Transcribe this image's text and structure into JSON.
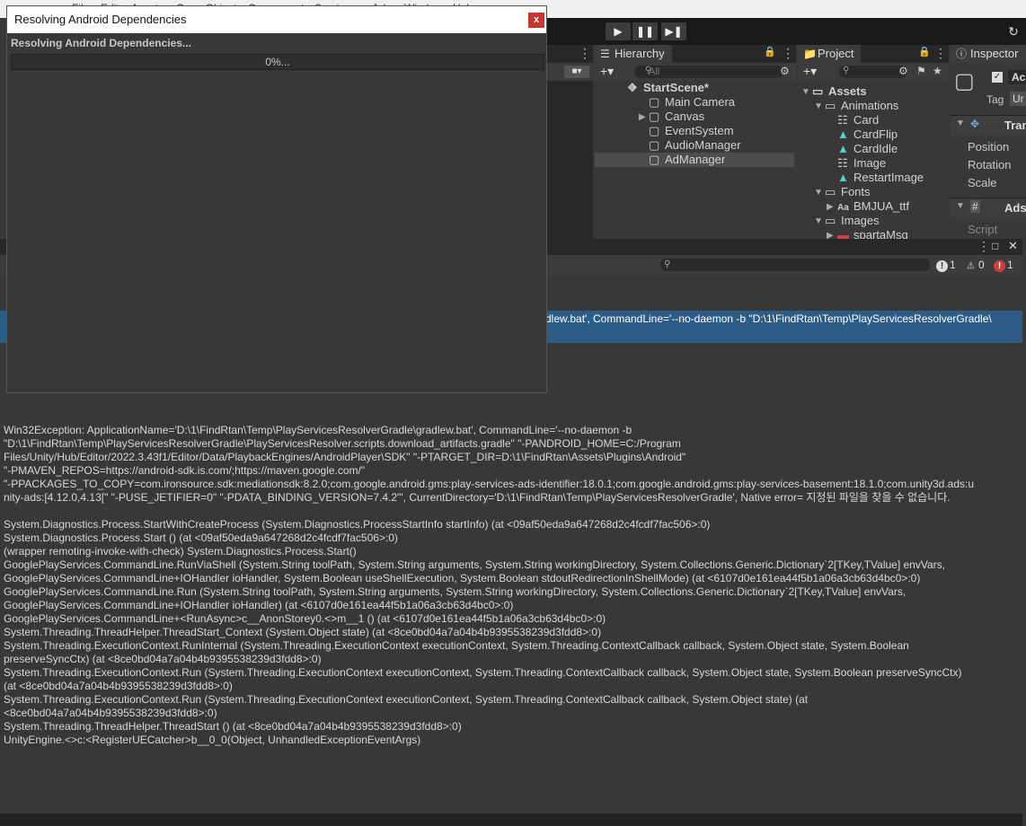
{
  "menubar": {
    "items": [
      "File",
      "Edit",
      "Assets",
      "GameObject",
      "Component",
      "Services",
      "Jobs",
      "Window",
      "Help"
    ]
  },
  "toolbar": {
    "play_icon": "play-icon",
    "pause_icon": "pause-icon",
    "step_icon": "step-icon",
    "history_icon": "history-icon"
  },
  "hierarchy": {
    "tab_label": "Hierarchy",
    "search_placeholder": "All",
    "scene": "StartScene*",
    "items": [
      {
        "label": "Main Camera",
        "expandable": false
      },
      {
        "label": "Canvas",
        "expandable": true
      },
      {
        "label": "EventSystem",
        "expandable": false
      },
      {
        "label": "AudioManager",
        "expandable": false
      },
      {
        "label": "AdManager",
        "expandable": false,
        "selected": true
      }
    ]
  },
  "project": {
    "tab_label": "Project",
    "tree": [
      {
        "label": "Assets",
        "type": "folder"
      },
      {
        "label": "Animations",
        "type": "folder"
      },
      {
        "label": "Card",
        "type": "controller"
      },
      {
        "label": "CardFlip",
        "type": "anim"
      },
      {
        "label": "CardIdle",
        "type": "anim"
      },
      {
        "label": "Image",
        "type": "controller"
      },
      {
        "label": "RestartImage",
        "type": "anim"
      },
      {
        "label": "Fonts",
        "type": "folder"
      },
      {
        "label": "BMJUA_ttf",
        "type": "font",
        "prefix": "Aa"
      },
      {
        "label": "Images",
        "type": "folder"
      },
      {
        "label": "spartaMsg",
        "type": "image"
      }
    ]
  },
  "inspector": {
    "tab_label": "Inspector",
    "tag_label": "Tag",
    "tag_value": "Ur",
    "name_partial": "Ac",
    "transform_label": "Tran",
    "position_label": "Position",
    "rotation_label": "Rotation",
    "scale_label": "Scale",
    "component_label": "Ads",
    "script_label": "Script"
  },
  "console": {
    "counts": {
      "log": "1",
      "warn": "0",
      "error": "1"
    },
    "selected_entry": "dlew.bat', CommandLine='--no-daemon -b \"D:\\1\\FindRtan\\Temp\\PlayServicesResolverGradle\\",
    "detail_lines": [
      "Win32Exception: ApplicationName='D:\\1\\FindRtan\\Temp\\PlayServicesResolverGradle\\gradlew.bat', CommandLine='--no-daemon -b",
      "\"D:\\1\\FindRtan\\Temp\\PlayServicesResolverGradle\\PlayServicesResolver.scripts.download_artifacts.gradle\" \"-PANDROID_HOME=C:/Program",
      "Files/Unity/Hub/Editor/2022.3.43f1/Editor/Data/PlaybackEngines/AndroidPlayer\\SDK\" \"-PTARGET_DIR=D:\\1\\FindRtan\\Assets\\Plugins\\Android\"",
      "\"-PMAVEN_REPOS=https://android-sdk.is.com/;https://maven.google.com/\"",
      "\"-PPACKAGES_TO_COPY=com.ironsource.sdk:mediationsdk:8.2.0;com.google.android.gms:play-services-ads-identifier:18.0.1;com.google.android.gms:play-services-basement:18.1.0;com.unity3d.ads:u",
      "nity-ads:[4.12.0,4.13[\" \"-PUSE_JETIFIER=0\" \"-PDATA_BINDING_VERSION=7.4.2\"', CurrentDirectory='D:\\1\\FindRtan\\Temp\\PlayServicesResolverGradle', Native error= 지정된 파일을 찾을 수 없습니다.",
      "",
      "System.Diagnostics.Process.StartWithCreateProcess (System.Diagnostics.ProcessStartInfo startInfo) (at <09af50eda9a647268d2c4fcdf7fac506>:0)",
      "System.Diagnostics.Process.Start () (at <09af50eda9a647268d2c4fcdf7fac506>:0)",
      "(wrapper remoting-invoke-with-check) System.Diagnostics.Process.Start()",
      "GooglePlayServices.CommandLine.RunViaShell (System.String toolPath, System.String arguments, System.String workingDirectory, System.Collections.Generic.Dictionary`2[TKey,TValue] envVars,",
      "GooglePlayServices.CommandLine+IOHandler ioHandler, System.Boolean useShellExecution, System.Boolean stdoutRedirectionInShellMode) (at <6107d0e161ea44f5b1a06a3cb63d4bc0>:0)",
      "GooglePlayServices.CommandLine.Run (System.String toolPath, System.String arguments, System.String workingDirectory, System.Collections.Generic.Dictionary`2[TKey,TValue] envVars,",
      "GooglePlayServices.CommandLine+IOHandler ioHandler) (at <6107d0e161ea44f5b1a06a3cb63d4bc0>:0)",
      "GooglePlayServices.CommandLine+<RunAsync>c__AnonStorey0.<>m__1 () (at <6107d0e161ea44f5b1a06a3cb63d4bc0>:0)",
      "System.Threading.ThreadHelper.ThreadStart_Context (System.Object state) (at <8ce0bd04a7a04b4b9395538239d3fdd8>:0)",
      "System.Threading.ExecutionContext.RunInternal (System.Threading.ExecutionContext executionContext, System.Threading.ContextCallback callback, System.Object state, System.Boolean",
      "preserveSyncCtx) (at <8ce0bd04a7a04b4b9395538239d3fdd8>:0)",
      "System.Threading.ExecutionContext.Run (System.Threading.ExecutionContext executionContext, System.Threading.ContextCallback callback, System.Object state, System.Boolean preserveSyncCtx)",
      "(at <8ce0bd04a7a04b4b9395538239d3fdd8>:0)",
      "System.Threading.ExecutionContext.Run (System.Threading.ExecutionContext executionContext, System.Threading.ContextCallback callback, System.Object state) (at",
      "<8ce0bd04a7a04b4b9395538239d3fdd8>:0)",
      "System.Threading.ThreadHelper.ThreadStart () (at <8ce0bd04a7a04b4b9395538239d3fdd8>:0)",
      "UnityEngine.<>c:<RegisterUECatcher>b__0_0(Object, UnhandledExceptionEventArgs)"
    ]
  },
  "dialog": {
    "title": "Resolving Android Dependencies",
    "heading": "Resolving Android Dependencies...",
    "progress_text": "0%...",
    "progress_value": 0,
    "close_label": "x"
  },
  "colors": {
    "selection": "#2c5d87",
    "panel": "#383838",
    "close_button": "#c8352b",
    "error": "#d33a3a"
  }
}
